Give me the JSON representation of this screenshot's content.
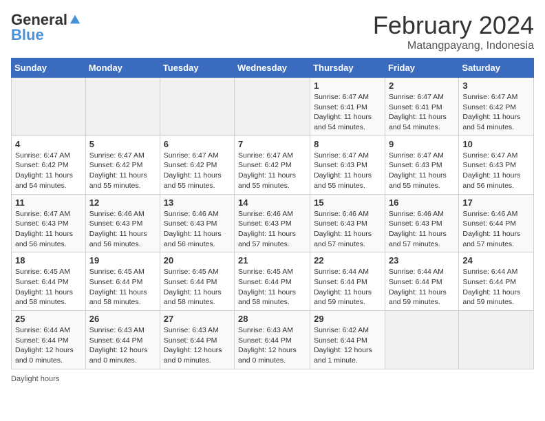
{
  "logo": {
    "general": "General",
    "blue": "Blue"
  },
  "title": "February 2024",
  "location": "Matangpayang, Indonesia",
  "days_header": [
    "Sunday",
    "Monday",
    "Tuesday",
    "Wednesday",
    "Thursday",
    "Friday",
    "Saturday"
  ],
  "weeks": [
    [
      {
        "day": "",
        "info": ""
      },
      {
        "day": "",
        "info": ""
      },
      {
        "day": "",
        "info": ""
      },
      {
        "day": "",
        "info": ""
      },
      {
        "day": "1",
        "info": "Sunrise: 6:47 AM\nSunset: 6:41 PM\nDaylight: 11 hours\nand 54 minutes."
      },
      {
        "day": "2",
        "info": "Sunrise: 6:47 AM\nSunset: 6:41 PM\nDaylight: 11 hours\nand 54 minutes."
      },
      {
        "day": "3",
        "info": "Sunrise: 6:47 AM\nSunset: 6:42 PM\nDaylight: 11 hours\nand 54 minutes."
      }
    ],
    [
      {
        "day": "4",
        "info": "Sunrise: 6:47 AM\nSunset: 6:42 PM\nDaylight: 11 hours\nand 54 minutes."
      },
      {
        "day": "5",
        "info": "Sunrise: 6:47 AM\nSunset: 6:42 PM\nDaylight: 11 hours\nand 55 minutes."
      },
      {
        "day": "6",
        "info": "Sunrise: 6:47 AM\nSunset: 6:42 PM\nDaylight: 11 hours\nand 55 minutes."
      },
      {
        "day": "7",
        "info": "Sunrise: 6:47 AM\nSunset: 6:42 PM\nDaylight: 11 hours\nand 55 minutes."
      },
      {
        "day": "8",
        "info": "Sunrise: 6:47 AM\nSunset: 6:43 PM\nDaylight: 11 hours\nand 55 minutes."
      },
      {
        "day": "9",
        "info": "Sunrise: 6:47 AM\nSunset: 6:43 PM\nDaylight: 11 hours\nand 55 minutes."
      },
      {
        "day": "10",
        "info": "Sunrise: 6:47 AM\nSunset: 6:43 PM\nDaylight: 11 hours\nand 56 minutes."
      }
    ],
    [
      {
        "day": "11",
        "info": "Sunrise: 6:47 AM\nSunset: 6:43 PM\nDaylight: 11 hours\nand 56 minutes."
      },
      {
        "day": "12",
        "info": "Sunrise: 6:46 AM\nSunset: 6:43 PM\nDaylight: 11 hours\nand 56 minutes."
      },
      {
        "day": "13",
        "info": "Sunrise: 6:46 AM\nSunset: 6:43 PM\nDaylight: 11 hours\nand 56 minutes."
      },
      {
        "day": "14",
        "info": "Sunrise: 6:46 AM\nSunset: 6:43 PM\nDaylight: 11 hours\nand 57 minutes."
      },
      {
        "day": "15",
        "info": "Sunrise: 6:46 AM\nSunset: 6:43 PM\nDaylight: 11 hours\nand 57 minutes."
      },
      {
        "day": "16",
        "info": "Sunrise: 6:46 AM\nSunset: 6:43 PM\nDaylight: 11 hours\nand 57 minutes."
      },
      {
        "day": "17",
        "info": "Sunrise: 6:46 AM\nSunset: 6:44 PM\nDaylight: 11 hours\nand 57 minutes."
      }
    ],
    [
      {
        "day": "18",
        "info": "Sunrise: 6:45 AM\nSunset: 6:44 PM\nDaylight: 11 hours\nand 58 minutes."
      },
      {
        "day": "19",
        "info": "Sunrise: 6:45 AM\nSunset: 6:44 PM\nDaylight: 11 hours\nand 58 minutes."
      },
      {
        "day": "20",
        "info": "Sunrise: 6:45 AM\nSunset: 6:44 PM\nDaylight: 11 hours\nand 58 minutes."
      },
      {
        "day": "21",
        "info": "Sunrise: 6:45 AM\nSunset: 6:44 PM\nDaylight: 11 hours\nand 58 minutes."
      },
      {
        "day": "22",
        "info": "Sunrise: 6:44 AM\nSunset: 6:44 PM\nDaylight: 11 hours\nand 59 minutes."
      },
      {
        "day": "23",
        "info": "Sunrise: 6:44 AM\nSunset: 6:44 PM\nDaylight: 11 hours\nand 59 minutes."
      },
      {
        "day": "24",
        "info": "Sunrise: 6:44 AM\nSunset: 6:44 PM\nDaylight: 11 hours\nand 59 minutes."
      }
    ],
    [
      {
        "day": "25",
        "info": "Sunrise: 6:44 AM\nSunset: 6:44 PM\nDaylight: 12 hours\nand 0 minutes."
      },
      {
        "day": "26",
        "info": "Sunrise: 6:43 AM\nSunset: 6:44 PM\nDaylight: 12 hours\nand 0 minutes."
      },
      {
        "day": "27",
        "info": "Sunrise: 6:43 AM\nSunset: 6:44 PM\nDaylight: 12 hours\nand 0 minutes."
      },
      {
        "day": "28",
        "info": "Sunrise: 6:43 AM\nSunset: 6:44 PM\nDaylight: 12 hours\nand 0 minutes."
      },
      {
        "day": "29",
        "info": "Sunrise: 6:42 AM\nSunset: 6:44 PM\nDaylight: 12 hours\nand 1 minute."
      },
      {
        "day": "",
        "info": ""
      },
      {
        "day": "",
        "info": ""
      }
    ]
  ],
  "footer": {
    "daylight_hours": "Daylight hours"
  }
}
